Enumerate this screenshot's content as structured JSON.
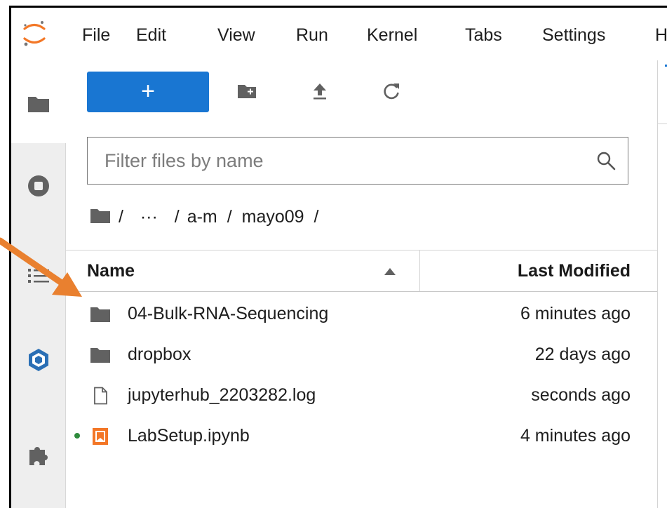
{
  "menu": {
    "items": [
      "File",
      "Edit",
      "View",
      "Run",
      "Kernel",
      "Tabs",
      "Settings",
      "H"
    ]
  },
  "activity_bar": {
    "icons": [
      "folder-icon",
      "stop-circle-icon",
      "list-icon",
      "hexagon-icon",
      "puzzle-icon"
    ]
  },
  "toolbar": {
    "new_label": "+",
    "icons": [
      "new-folder-icon",
      "upload-icon",
      "refresh-icon"
    ]
  },
  "filter": {
    "placeholder": "Filter files by name",
    "value": ""
  },
  "breadcrumb": {
    "sep1": "/",
    "ellipsis": "···",
    "sep2": "/",
    "part1": "a-m",
    "sep3": "/",
    "part2": "mayo09",
    "sep4": "/"
  },
  "columns": {
    "name": "Name",
    "modified": "Last Modified",
    "sort": "ascending"
  },
  "files": [
    {
      "name": "04-Bulk-RNA-Sequencing",
      "modified": "6 minutes ago",
      "type": "folder",
      "running": false
    },
    {
      "name": "dropbox",
      "modified": "22 days ago",
      "type": "folder",
      "running": false
    },
    {
      "name": "jupyterhub_2203282.log",
      "modified": "seconds ago",
      "type": "file",
      "running": false
    },
    {
      "name": "LabSetup.ipynb",
      "modified": "4 minutes ago",
      "type": "notebook",
      "running": true
    }
  ],
  "colors": {
    "accent": "#1976d2",
    "annotation_arrow": "#e9802f",
    "notebook_icon": "#f37626",
    "running_dot": "#2e8b3c"
  }
}
